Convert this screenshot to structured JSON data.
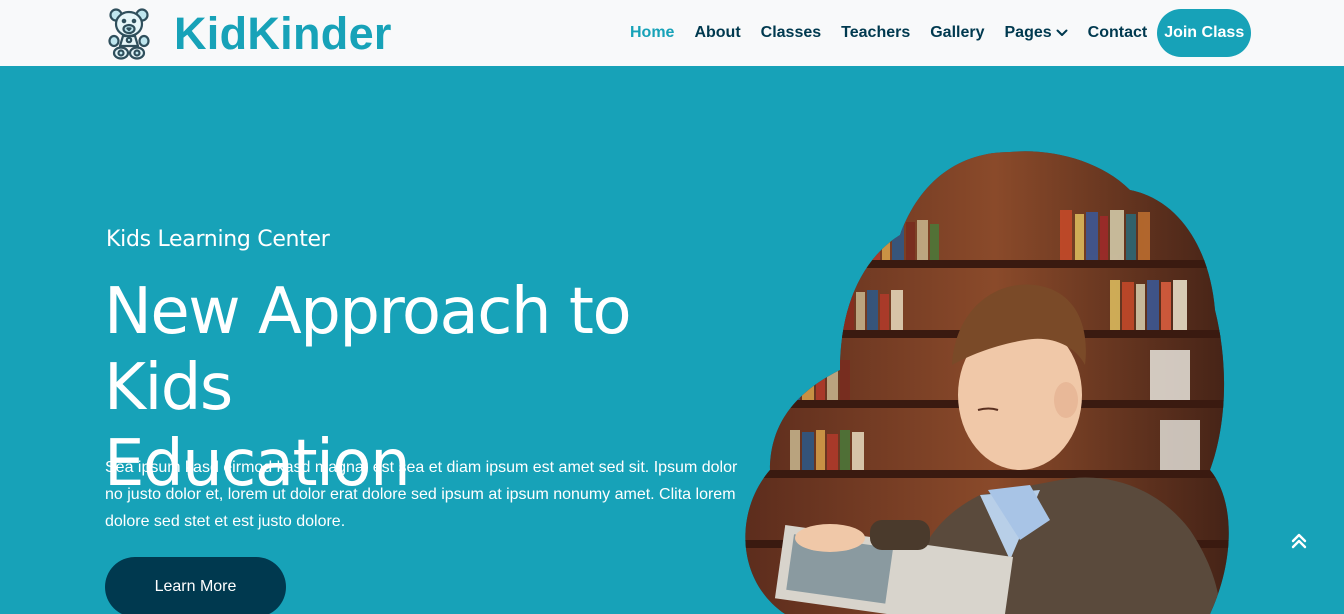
{
  "brand": {
    "name": "KidKinder",
    "logo_icon": "teddy-bear-icon",
    "color": "#17a2b8"
  },
  "nav": {
    "items": [
      {
        "label": "Home",
        "active": true
      },
      {
        "label": "About"
      },
      {
        "label": "Classes"
      },
      {
        "label": "Teachers"
      },
      {
        "label": "Gallery"
      },
      {
        "label": "Pages",
        "dropdown": true
      },
      {
        "label": "Contact"
      }
    ],
    "cta_label": "Join Class"
  },
  "hero": {
    "eyebrow": "Kids Learning Center",
    "title_line1": "New Approach to Kids",
    "title_line2": "Education",
    "description": "Sea ipsum kasd eirmod kasd magna, est sea et diam ipsum est amet sed sit. Ipsum dolor no justo dolor et, lorem ut dolor erat dolore sed ipsum at ipsum nonumy amet. Clita lorem dolore sed stet et est justo dolore.",
    "button_label": "Learn More",
    "image_icon": "boy-reading-book-image"
  },
  "colors": {
    "primary": "#17a2b8",
    "dark": "#00394f",
    "navbar_bg": "#f8f9fa",
    "white": "#ffffff"
  },
  "scroll_top_icon": "double-chevron-up-icon"
}
